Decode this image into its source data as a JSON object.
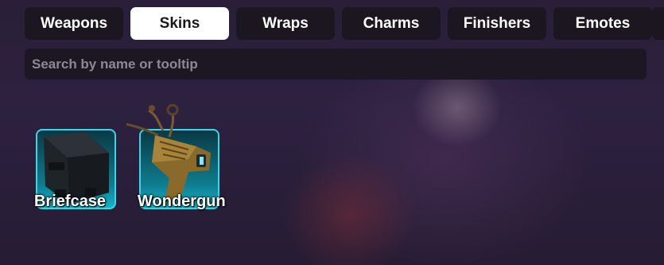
{
  "tabs": [
    {
      "label": "Weapons",
      "active": false
    },
    {
      "label": "Skins",
      "active": true
    },
    {
      "label": "Wraps",
      "active": false
    },
    {
      "label": "Charms",
      "active": false
    },
    {
      "label": "Finishers",
      "active": false
    },
    {
      "label": "Emotes",
      "active": false
    }
  ],
  "search": {
    "placeholder": "Search by name or tooltip",
    "value": ""
  },
  "items": [
    {
      "name": "Briefcase",
      "icon": "briefcase-icon"
    },
    {
      "name": "Wondergun",
      "icon": "wondergun-icon"
    }
  ],
  "colors": {
    "item_border": "#3fd3e8",
    "active_tab": "#ffffff",
    "tab_bg": "#1b1620"
  }
}
